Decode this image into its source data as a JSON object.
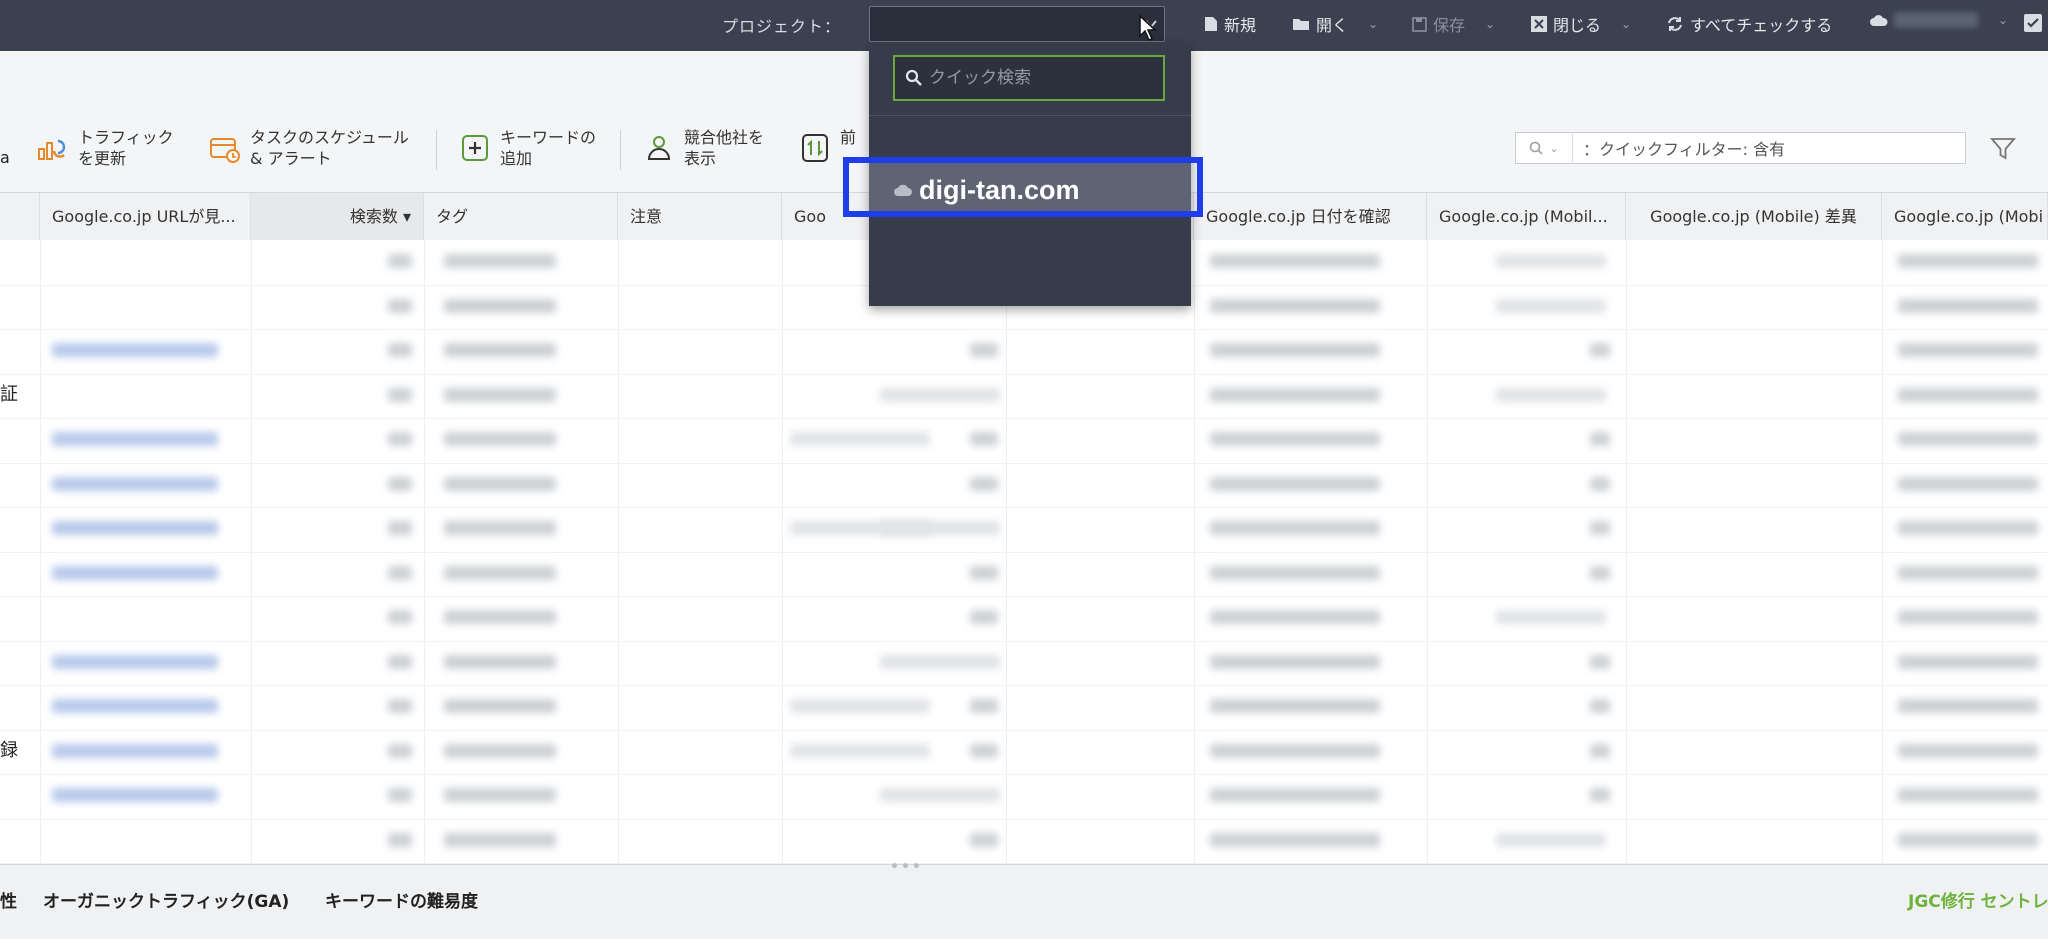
{
  "topbar": {
    "project_label": "プロジェクト：",
    "new_label": "新規",
    "open_label": "開く",
    "save_label": "保存",
    "close_label": "閉じる",
    "check_all_label": "すべてチェックする"
  },
  "toolbar": {
    "edge_text": "a",
    "traffic": {
      "line1": "トラフィック",
      "line2": "を更新"
    },
    "schedule": {
      "line1": "タスクのスケジュール",
      "line2": "& アラート"
    },
    "add_keyword": {
      "line1": "キーワードの",
      "line2": "追加"
    },
    "competitors": {
      "line1": "競合他社を",
      "line2": "表示"
    },
    "prev": {
      "line1": "前"
    },
    "quick_filter": "：クイックフィルター: 含有"
  },
  "dropdown": {
    "search_placeholder": "クイック検索",
    "project_name": "digi-tan.com"
  },
  "grid": {
    "columns": [
      "Google.co.jp URLが見...",
      "検索数 ▾",
      "タグ",
      "注意",
      "Goo",
      "",
      "Google.co.jp 日付を確認",
      "Google.co.jp (Mobil...",
      "Google.co.jp (Mobile) 差異",
      "Google.co.jp (Mobi"
    ],
    "edge_rows": {
      "row4": "証",
      "row12": "録"
    }
  },
  "bottombar": {
    "tab1": "性",
    "tab2": "オーガニックトラフィック(GA)",
    "tab3": "キーワードの難易度",
    "right_tab": "JGC修行 セントレ"
  },
  "colors": {
    "highlight": "#1f3de8",
    "search_border": "#6aa73a",
    "topbar": "#3b4150",
    "dropdown": "#373c4a"
  }
}
